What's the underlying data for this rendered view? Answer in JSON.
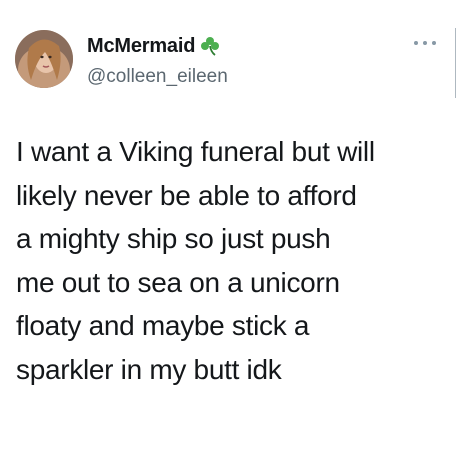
{
  "author": {
    "display_name": "McMermaid",
    "handle": "@colleen_eileen",
    "name_emoji": "shamrock-icon",
    "avatar": "avatar-photo"
  },
  "tweet": {
    "lines": [
      "I want a Viking funeral but will",
      "likely never be able to afford",
      "a mighty ship so just push",
      "me out to sea on a unicorn",
      "floaty and maybe stick a",
      "sparkler in my butt idk"
    ]
  },
  "actions": {
    "more_icon": "more-options-icon"
  },
  "colors": {
    "text": "#14171a",
    "secondary": "#5b6770",
    "shamrock": "#4caf50"
  }
}
